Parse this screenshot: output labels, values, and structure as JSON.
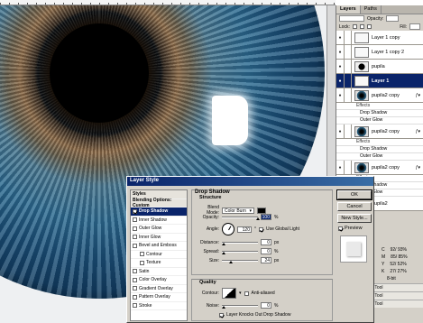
{
  "layers_panel": {
    "tabs": [
      "Layers",
      "Paths"
    ],
    "opacity_label": "Opacity:",
    "fill_label": "Fill:",
    "lock_label": "Lock:",
    "layers": [
      {
        "name": "Layer 1 copy",
        "thumb": "blank",
        "selected": false
      },
      {
        "name": "Layer 1 copy 2",
        "thumb": "blank",
        "selected": false
      },
      {
        "name": "pupila",
        "thumb": "pupil",
        "selected": false
      },
      {
        "name": "Layer 1",
        "thumb": "blank",
        "selected": true
      },
      {
        "name": "pupila2 copy",
        "thumb": "eye",
        "selected": false
      }
    ],
    "effects_a": [
      "Effects",
      "Drop Shadow",
      "Outer Glow"
    ],
    "layer_b": "pupila2 copy",
    "effects_b": [
      "Effects",
      "Drop Shadow",
      "Outer Glow",
      "Outer Glow"
    ],
    "layer_c": "pupila2 copy",
    "bottom_layer": "pupila2",
    "info": [
      {
        "label": "C",
        "value": "92/ 93%"
      },
      {
        "label": "M",
        "value": "85/ 85%"
      },
      {
        "label": "Y",
        "value": "52/ 52%"
      },
      {
        "label": "K",
        "value": "27/ 27%"
      },
      {
        "label": "",
        "value": "8-bit"
      }
    ],
    "history": [
      "Brush Tool",
      "Brush Tool",
      "Brush Tool"
    ]
  },
  "dialog": {
    "title": "Layer Style",
    "styles_header": "Styles",
    "styles": [
      {
        "label": "Blending Options: Custom",
        "type": "head",
        "checked": false
      },
      {
        "label": "Drop Shadow",
        "type": "sel",
        "checked": true
      },
      {
        "label": "Inner Shadow",
        "type": "item",
        "checked": false
      },
      {
        "label": "Outer Glow",
        "type": "item",
        "checked": false
      },
      {
        "label": "Inner Glow",
        "type": "item",
        "checked": false
      },
      {
        "label": "Bevel and Emboss",
        "type": "item",
        "checked": false
      },
      {
        "label": "Contour",
        "type": "sub",
        "checked": false
      },
      {
        "label": "Texture",
        "type": "sub",
        "checked": false
      },
      {
        "label": "Satin",
        "type": "item",
        "checked": false
      },
      {
        "label": "Color Overlay",
        "type": "item",
        "checked": false
      },
      {
        "label": "Gradient Overlay",
        "type": "item",
        "checked": false
      },
      {
        "label": "Pattern Overlay",
        "type": "item",
        "checked": false
      },
      {
        "label": "Stroke",
        "type": "item",
        "checked": false
      }
    ],
    "group_title": "Drop Shadow",
    "structure": "Structure",
    "blend_mode_label": "Blend Mode:",
    "blend_mode": "Color Burn",
    "opacity_label": "Opacity:",
    "opacity_value": "100",
    "angle_label": "Angle:",
    "angle_value": "120",
    "use_global_light": "Use Global Light",
    "distance_label": "Distance:",
    "distance_value": "0",
    "spread_label": "Spread:",
    "spread_value": "0",
    "size_label": "Size:",
    "size_value": "24",
    "px": "px",
    "pct": "%",
    "deg": "°",
    "quality": "Quality",
    "contour_label": "Contour:",
    "anti_aliased": "Anti-aliased",
    "noise_label": "Noise:",
    "noise_value": "0",
    "knockout": "Layer Knocks Out Drop Shadow",
    "buttons": {
      "ok": "OK",
      "cancel": "Cancel",
      "new_style": "New Style...",
      "preview": "Preview"
    }
  }
}
